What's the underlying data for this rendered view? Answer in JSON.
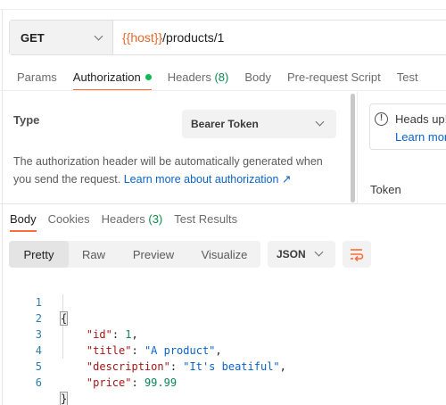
{
  "request": {
    "method": "GET",
    "url_var": "{{host}}",
    "url_path": "/products/1"
  },
  "request_tabs": [
    {
      "label": "Params"
    },
    {
      "label": "Authorization"
    },
    {
      "label": "Headers",
      "count": "(8)"
    },
    {
      "label": "Body"
    },
    {
      "label": "Pre-request Script"
    },
    {
      "label": "Test"
    }
  ],
  "auth": {
    "type_label": "Type",
    "type_value": "Bearer Token",
    "help_text": "The authorization header will be automatically generated when you send the request.",
    "help_link": "Learn more about authorization ↗",
    "info_title": "Heads up!",
    "info_link": "Learn more",
    "token_label": "Token"
  },
  "response_tabs": [
    {
      "label": "Body"
    },
    {
      "label": "Cookies"
    },
    {
      "label": "Headers",
      "count": "(3)"
    },
    {
      "label": "Test Results"
    }
  ],
  "view_modes": [
    "Pretty",
    "Raw",
    "Preview",
    "Visualize"
  ],
  "format": "JSON",
  "code_lines": [
    {
      "num": "1",
      "text": "{"
    },
    {
      "num": "2",
      "key": "\"id\"",
      "value": "1",
      "vtype": "n",
      "comma": ","
    },
    {
      "num": "3",
      "key": "\"title\"",
      "value": "\"A product\"",
      "vtype": "s",
      "comma": ","
    },
    {
      "num": "4",
      "key": "\"description\"",
      "value": "\"It's beatiful\"",
      "vtype": "s",
      "comma": ","
    },
    {
      "num": "5",
      "key": "\"price\"",
      "value": "99.99",
      "vtype": "n",
      "comma": ""
    },
    {
      "num": "6",
      "text": "}"
    }
  ],
  "colors": {
    "accent": "#ff6c37",
    "url_variable": "#e8672a",
    "status_green": "#0cbb52",
    "link": "#0b64c8",
    "json_key": "#a31515",
    "json_string": "#0b64c8",
    "json_number": "#098658"
  }
}
